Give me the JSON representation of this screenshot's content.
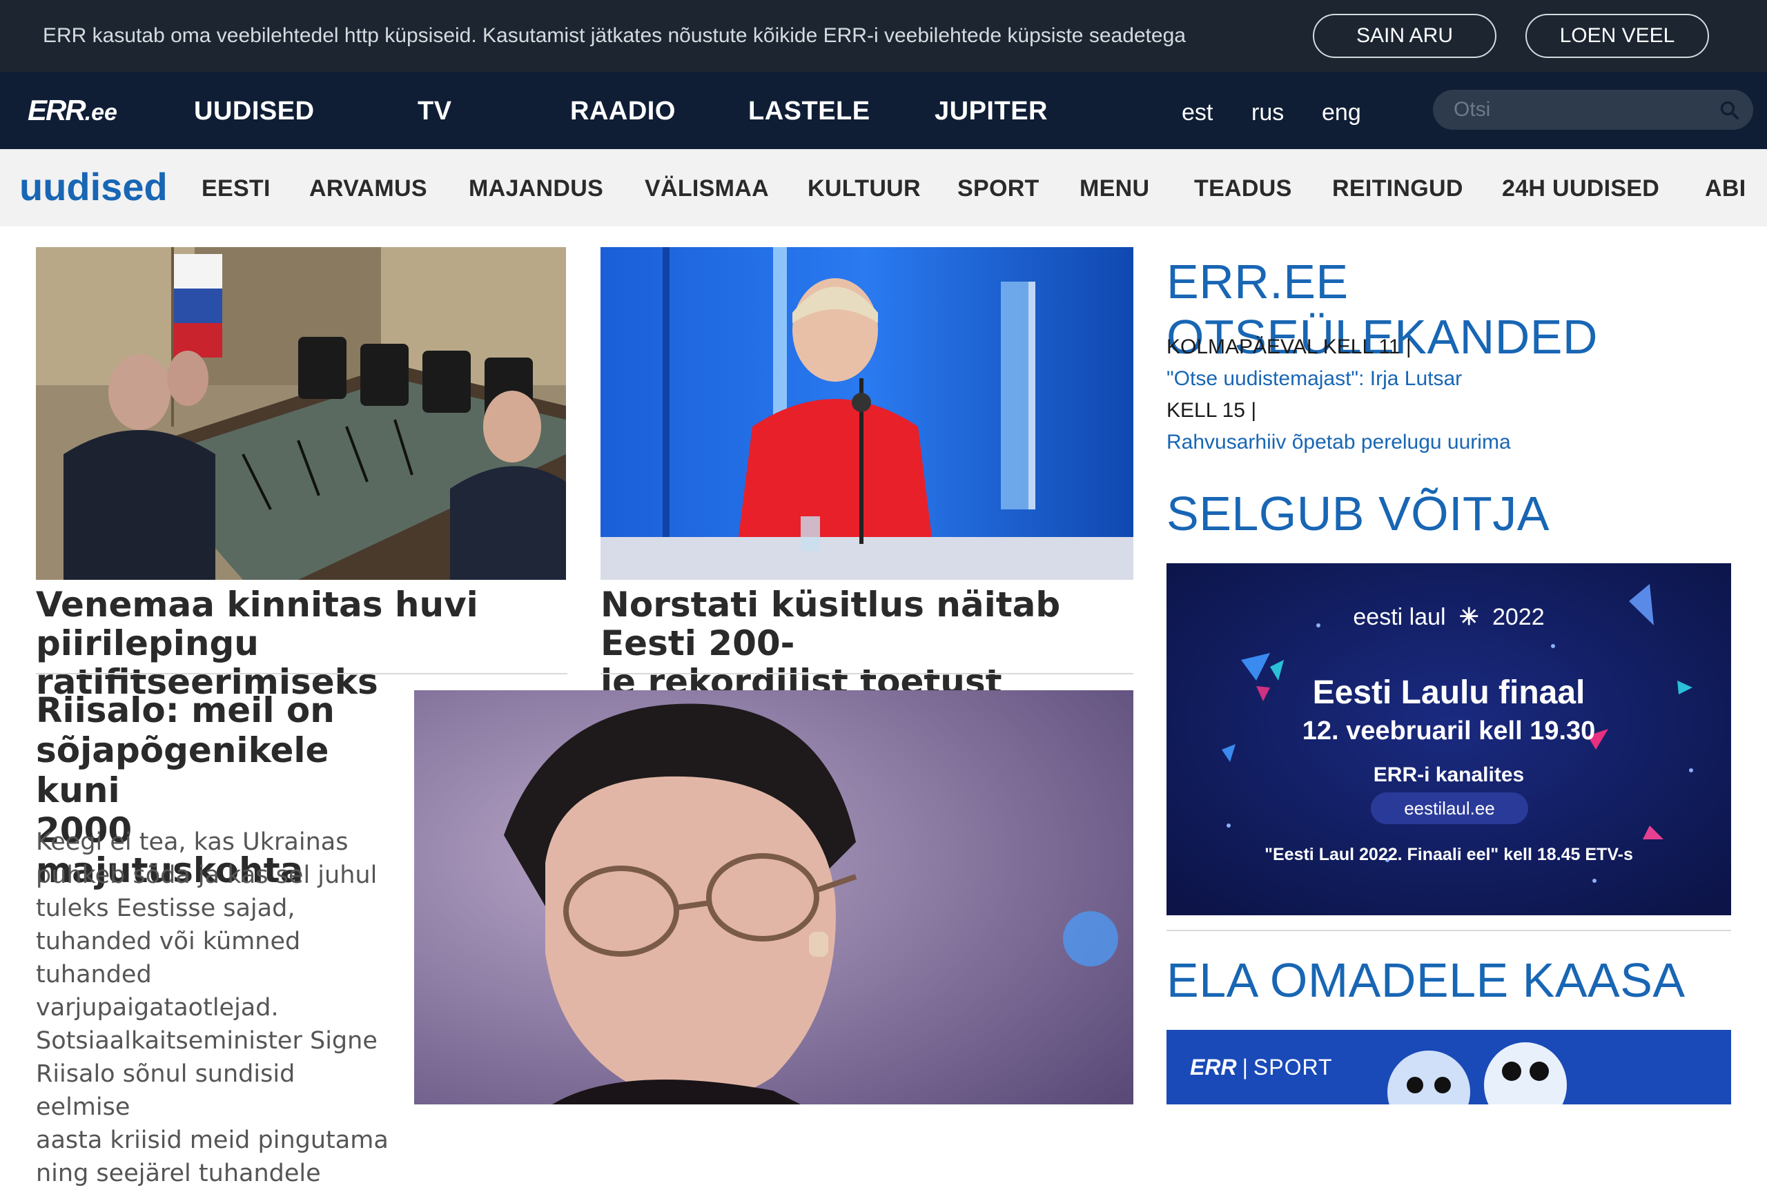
{
  "cookie_bar": {
    "text": "ERR kasutab oma veebilehtedel http küpsiseid. Kasutamist jätkates nõustute kõikide ERR-i veebilehtede küpsiste seadetega",
    "accept_label": "SAIN ARU",
    "more_label": "LOEN VEEL"
  },
  "header": {
    "logo_err": "ERR",
    "logo_ee": ".ee",
    "nav": [
      "UUDISED",
      "TV",
      "RAADIO",
      "LASTELE",
      "JUPITER"
    ],
    "languages": [
      "est",
      "rus",
      "eng"
    ],
    "search_placeholder": "Otsi"
  },
  "subnav": {
    "section": "uudised",
    "items": [
      "EESTI",
      "ARVAMUS",
      "MAJANDUS",
      "VÄLISMAA",
      "KULTUUR",
      "SPORT",
      "MENU",
      "TEADUS",
      "REITINGUD",
      "24H UUDISED",
      "ABI"
    ]
  },
  "articles": {
    "a1_line1": "Venemaa kinnitas huvi",
    "a1_line2": "piirilepingu ratifitseerimiseks",
    "a2_line1": "Norstati küsitlus näitab Eesti 200-",
    "a2_line2": "le rekordilist toetust",
    "a3_line1": "Riisalo: meil on",
    "a3_line2": "sõjapõgenikele kuni",
    "a3_line3": "2000 majutuskohta",
    "a3_lead": [
      "Keegi ei tea, kas Ukrainas",
      "puhkeb sõda ja kas sel juhul",
      "tuleks Eestisse sajad,",
      "tuhanded või kümned",
      "tuhanded varjupaigataotlejad.",
      "Sotsiaalkaitseminister Signe",
      "Riisalo sõnul sundisid eelmise",
      "aasta kriisid meid pingutama",
      "ning seejärel tuhandele"
    ]
  },
  "sidebar": {
    "live_title": "ERR.EE OTSEÜLEKANDED",
    "live_time1": "KOLMAPÄEVAL KELL 11 |",
    "live_link1": "\"Otse uudistemajast\": Irja Lutsar",
    "live_time2": "KELL 15 |",
    "live_link2": "Rahvusarhiiv õpetab perelugu uurima",
    "winner_title": "SELGUB VÕITJA",
    "banner": {
      "brand_left": "eesti laul",
      "brand_year": "2022",
      "headline": "Eesti Laulu finaal",
      "date": "12. veebruaril kell 19.30",
      "channels": "ERR-i kanalites",
      "url": "eestilaul.ee",
      "pre_show": "\"Eesti Laul 2022. Finaali eel\" kell 18.45 ETV-s"
    },
    "cheer_title": "ELA OMADELE KAASA",
    "sport_brand_err": "ERR",
    "sport_brand_label": "SPORT"
  },
  "colors": {
    "cookie_bg": "#1c2530",
    "nav_bg": "#0f1e35",
    "subnav_bg": "#f2f2f2",
    "accent_blue": "#1866b4",
    "banner_bg": "#111b5c"
  }
}
